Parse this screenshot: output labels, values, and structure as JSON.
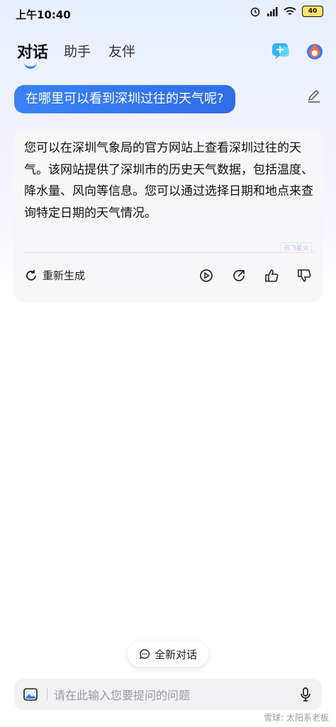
{
  "status": {
    "time": "上午10:40",
    "battery": "40",
    "icons": [
      "alarm-icon",
      "signal-icon",
      "wifi-icon",
      "battery-icon"
    ]
  },
  "nav": {
    "tabs": [
      {
        "label": "对话",
        "active": true
      },
      {
        "label": "助手"
      },
      {
        "label": "友伴"
      }
    ],
    "right_icons": [
      "new-chat-icon",
      "app-logo-icon"
    ]
  },
  "question": {
    "text": "在哪里可以看到深圳过往的天气呢?"
  },
  "answer": {
    "text": "您可以在深圳气象局的官方网站上查看深圳过往的天气。该网站提供了深圳市的历史天气数据，包括温度、降水量、风向等信息。您可以通过选择日期和地点来查询特定日期的天气情况。",
    "watermark": "讯飞星火",
    "regenerate_label": "重新生成",
    "actions": [
      "play-icon",
      "share-icon",
      "thumbs-up-icon",
      "thumbs-down-icon"
    ]
  },
  "new_chat": {
    "label": "全新对话"
  },
  "input": {
    "placeholder": "请在此输入您要提问的问题"
  },
  "footer_watermark": "雪球: 太阳系老板",
  "colors": {
    "accent": "#2f7bf6",
    "bubble": "#3479f2"
  }
}
